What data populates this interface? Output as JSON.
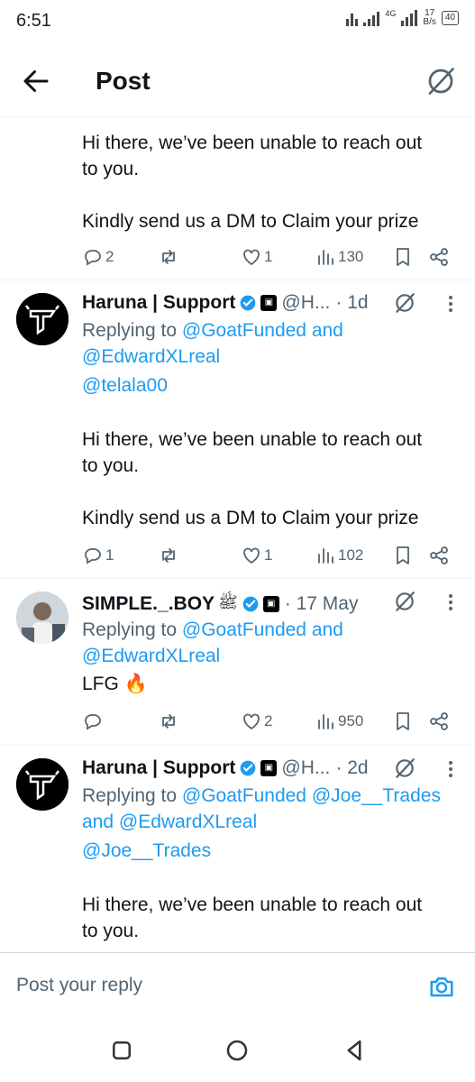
{
  "status_bar": {
    "time": "6:51",
    "network": "4G",
    "speed_value": "17",
    "speed_unit": "B/s",
    "battery": "40"
  },
  "header": {
    "title": "Post"
  },
  "tweets": [
    {
      "body_lines": [
        "Hi there, we’ve been unable to reach out",
        "to you."
      ],
      "body_lines_2": [
        "Kindly send us a DM to Claim your prize"
      ],
      "actions": {
        "replies": "2",
        "reposts": "",
        "likes": "1",
        "views": "130"
      }
    },
    {
      "author": "Haruna | Support",
      "handle": "@H...",
      "time": "· 1d",
      "reply_prefix": "Replying to",
      "reply_to_1": "@GoatFunded",
      "reply_and": "and",
      "reply_to_2": "@EdwardXLreal",
      "mention": "@telala00",
      "body_lines": [
        "Hi there, we’ve been unable to reach out",
        "to you."
      ],
      "body_lines_2": [
        "Kindly send us a DM to Claim your prize"
      ],
      "actions": {
        "replies": "1",
        "reposts": "",
        "likes": "1",
        "views": "102"
      }
    },
    {
      "author": "SIMPLE._.BOY",
      "name_glyph": "ﷺ",
      "time": "· 17 May",
      "reply_prefix": "Replying to",
      "reply_to_1": "@GoatFunded",
      "reply_and": "and",
      "reply_to_2": "@EdwardXLreal",
      "body": "LFG 🔥",
      "actions": {
        "replies": "",
        "reposts": "",
        "likes": "2",
        "views": "950"
      }
    },
    {
      "author": "Haruna | Support",
      "handle": "@H...",
      "time": "· 2d",
      "reply_prefix": "Replying to",
      "reply_to_1": "@GoatFunded",
      "reply_to_2": "@Joe__Trades",
      "reply_and": "and",
      "reply_to_3": "@EdwardXLreal",
      "mention": "@Joe__Trades",
      "body_lines": [
        "Hi there, we’ve been unable to reach out",
        "to you."
      ]
    }
  ],
  "reply_bar": {
    "placeholder": "Post your reply"
  },
  "icons": {
    "back": "arrow-left-icon",
    "grok": "grok-icon",
    "reply": "comment-icon",
    "repost": "repost-icon",
    "like": "heart-icon",
    "views": "views-icon",
    "bookmark": "bookmark-icon",
    "share": "share-icon",
    "verified": "verified-badge-icon",
    "camera": "camera-icon",
    "more": "more-vertical-icon"
  },
  "colors": {
    "accent": "#1d9bf0",
    "text": "#0f1419",
    "muted": "#536471"
  }
}
